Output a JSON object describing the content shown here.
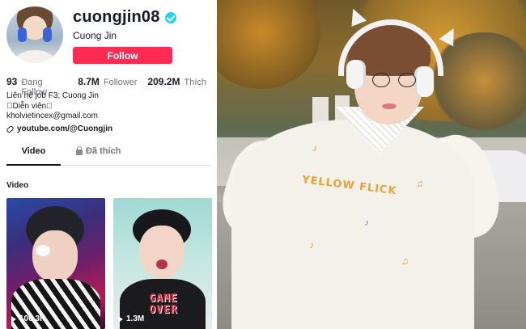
{
  "profile": {
    "username": "cuongjin08",
    "nickname": "Cuong Jin",
    "follow_label": "Follow",
    "stats": [
      {
        "value": "93",
        "label": "Đang Follow"
      },
      {
        "value": "8.7M",
        "label": "Follower"
      },
      {
        "value": "209.2M",
        "label": "Thích"
      }
    ],
    "bio_lines": [
      "Liên hệ job F3: Cuong Jin",
      "􏰀Diễn viên􏰀",
      "kholvietincex@gmail.com"
    ],
    "link": "youtube.com/@Cuongjin"
  },
  "tabs": {
    "video": "Video",
    "liked": "Đã thích"
  },
  "section_title": "Video",
  "videos": [
    {
      "views": "100.3K"
    },
    {
      "views": "1.3M",
      "overlay": "GAME OVER"
    }
  ],
  "photo": {
    "shirt_print": "YELLOW FLICK"
  },
  "colors": {
    "follow_button": "#fe2c55",
    "verified_badge": "#20d5ec",
    "text_primary": "#161823",
    "text_secondary": "#73747b"
  },
  "icons": [
    "verified-icon",
    "link-icon",
    "lock-icon",
    "play-icon"
  ]
}
